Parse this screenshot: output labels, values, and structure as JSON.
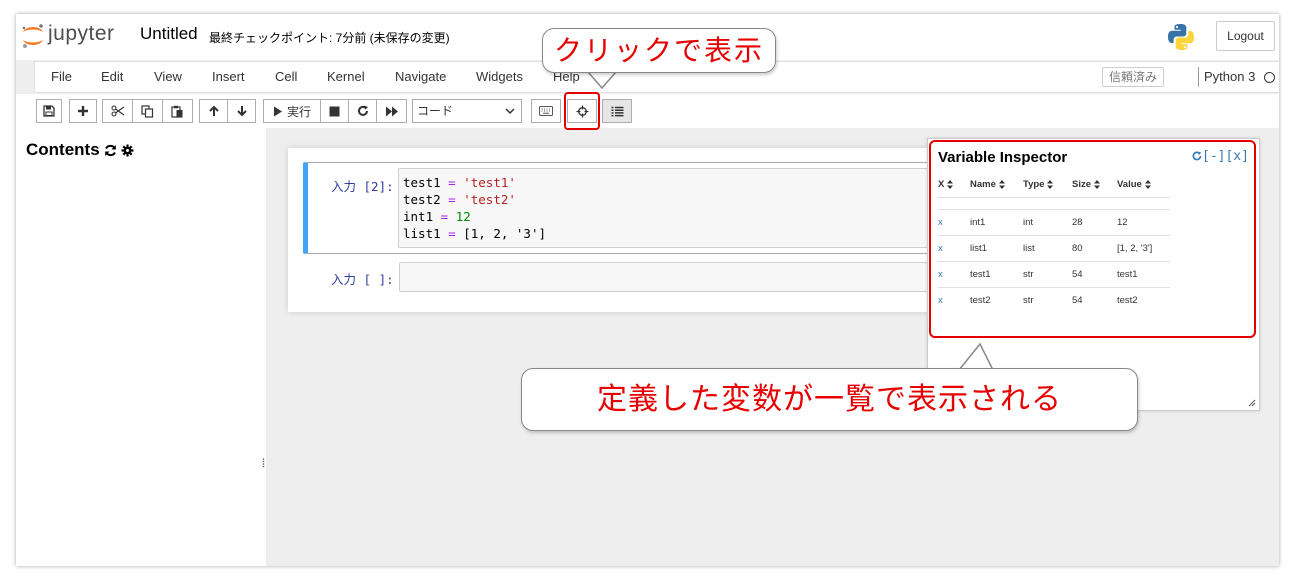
{
  "header": {
    "logo_text": "jupyter",
    "notebook_title": "Untitled",
    "checkpoint": "最終チェックポイント: 7分前  (未保存の変更)",
    "logout_label": "Logout"
  },
  "menubar": {
    "items": [
      "File",
      "Edit",
      "View",
      "Insert",
      "Cell",
      "Kernel",
      "Navigate",
      "Widgets",
      "Help"
    ],
    "trusted_label": "信頼済み",
    "kernel_name": "Python 3"
  },
  "toolbar": {
    "run_label": "実行",
    "cell_type": "コード"
  },
  "sidebar": {
    "title": "Contents"
  },
  "notebook": {
    "cells": [
      {
        "prompt": "入力 [2]:",
        "code": [
          [
            "test1",
            " = ",
            "'test1'"
          ],
          [
            "test2",
            " = ",
            "'test2'"
          ],
          [
            "int1",
            " = ",
            "12"
          ],
          [
            "list1",
            " = ",
            "[1, 2, '3']"
          ]
        ]
      },
      {
        "prompt": "入力 [ ]:",
        "code": []
      }
    ]
  },
  "variable_inspector": {
    "title": "Variable Inspector",
    "controls": "[-][x]",
    "columns": [
      "X",
      "Name",
      "Type",
      "Size",
      "Value"
    ],
    "rows": [
      {
        "x": "x",
        "name": "int1",
        "type": "int",
        "size": "28",
        "value": "12"
      },
      {
        "x": "x",
        "name": "list1",
        "type": "list",
        "size": "80",
        "value": "[1, 2, '3']"
      },
      {
        "x": "x",
        "name": "test1",
        "type": "str",
        "size": "54",
        "value": "test1"
      },
      {
        "x": "x",
        "name": "test2",
        "type": "str",
        "size": "54",
        "value": "test2"
      }
    ]
  },
  "callouts": {
    "top": "クリックで表示",
    "bottom": "定義した変数が一覧で表示される"
  },
  "colors": {
    "highlight": "#e50000",
    "callout_text": "#e60000",
    "cell_border_active": "#42a5f5",
    "link_blue": "#337ab7"
  }
}
